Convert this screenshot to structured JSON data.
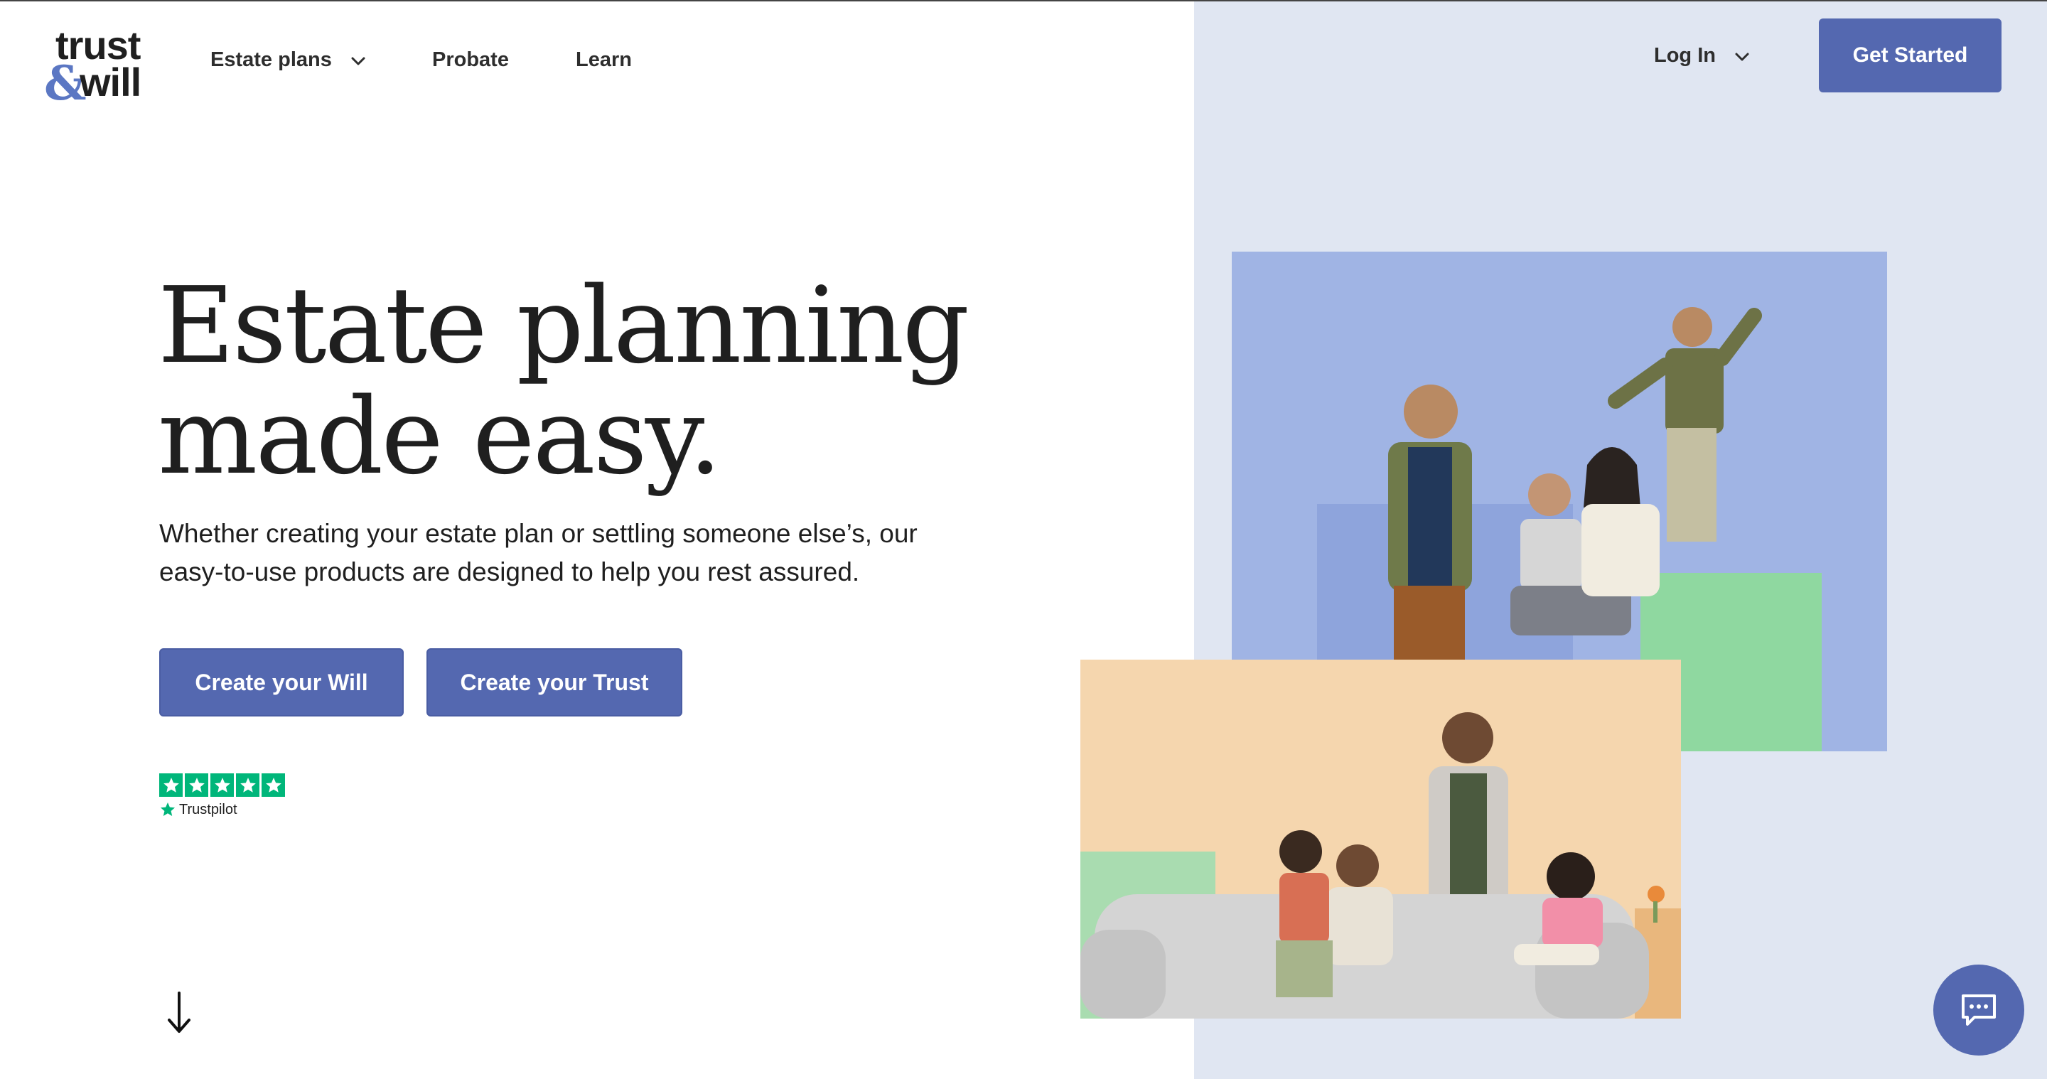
{
  "header": {
    "logo_line1": "trust",
    "logo_amp": "&",
    "logo_line2": "will",
    "nav": {
      "estate_plans": "Estate plans",
      "probate": "Probate",
      "learn": "Learn"
    },
    "login": "Log In",
    "get_started": "Get Started"
  },
  "hero": {
    "title_line1": "Estate planning",
    "title_line2": "made easy.",
    "subtitle_line1": "Whether creating your estate plan or settling someone else’s, our",
    "subtitle_line2": "easy-to-use products are designed to help you rest assured.",
    "cta_will": "Create your Will",
    "cta_trust": "Create your Trust"
  },
  "trustpilot": {
    "rating_stars": 5,
    "label": "Trustpilot"
  },
  "icons": {
    "nav_dropdown": "chevron-down-icon",
    "scroll": "arrow-down-icon",
    "chat": "chat-bubble-icon"
  },
  "colors": {
    "brand": "#5468b0",
    "panel": "#e0e6f2",
    "trustpilot_green": "#00b67a"
  }
}
